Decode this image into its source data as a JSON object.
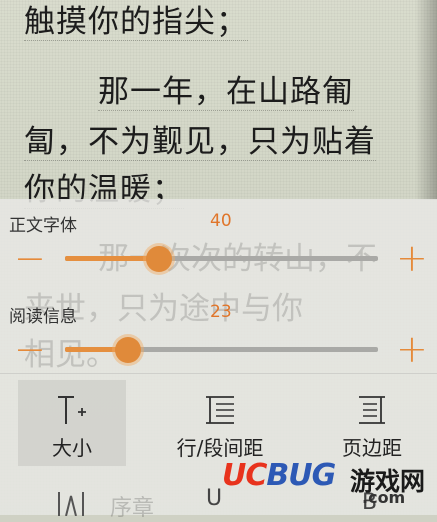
{
  "reader": {
    "lines": [
      "触摸你的指尖；",
      "那一年，在山路匍",
      "匐，不为觐见，只为贴着",
      "你的温暖；"
    ],
    "faded_lines": [
      "那一次次的转山，不",
      "来世，只为途中与你",
      "相见。"
    ]
  },
  "settings": {
    "font": {
      "label": "正文字体",
      "value": "40",
      "fraction": 0.3
    },
    "info": {
      "label": "阅读信息",
      "value": "23",
      "fraction": 0.2
    },
    "minus": "−",
    "plus": "+"
  },
  "tools": [
    {
      "label": "大小",
      "icon": "text-size-icon"
    },
    {
      "label": "行/段间距",
      "icon": "line-spacing-icon"
    },
    {
      "label": "页边距",
      "icon": "page-margin-icon"
    }
  ],
  "bottom_tools": [
    "序章",
    "U",
    "B"
  ],
  "watermark": {
    "brand": "UCBUG",
    "cn": "游戏网",
    "domain": ".com"
  },
  "colors": {
    "accent": "#e58a3a",
    "value_text": "#e0752a"
  }
}
